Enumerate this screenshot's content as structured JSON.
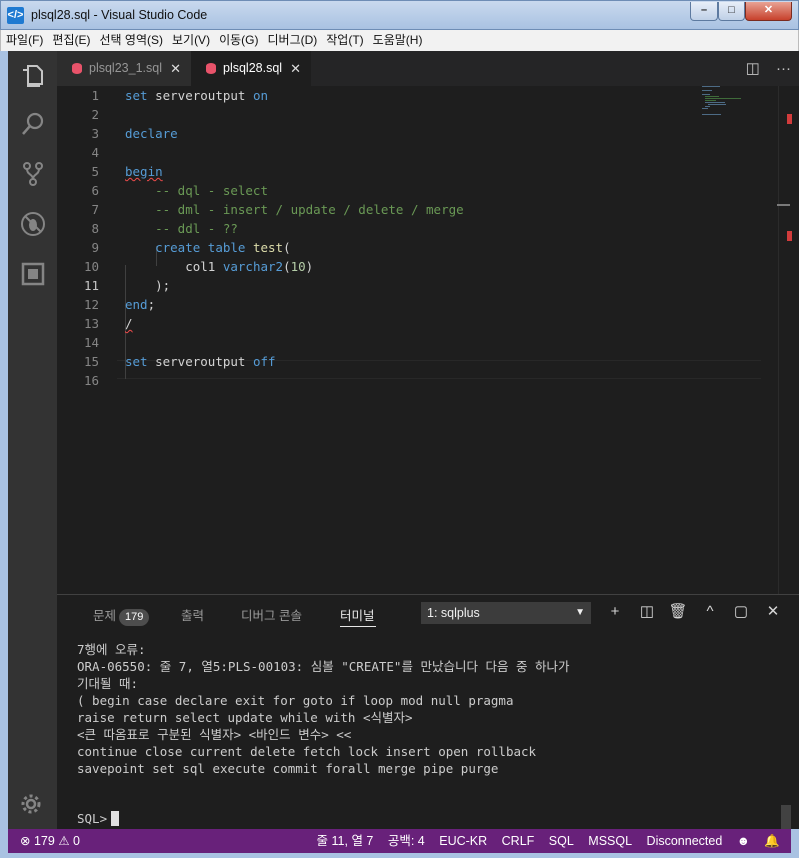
{
  "window": {
    "title": "plsql28.sql - Visual Studio Code",
    "min": "–",
    "max": "□",
    "close": "✕"
  },
  "menu": [
    "파일(F)",
    "편집(E)",
    "선택 영역(S)",
    "보기(V)",
    "이동(G)",
    "디버그(D)",
    "작업(T)",
    "도움말(H)"
  ],
  "tabs": [
    {
      "label": "plsql23_1.sql",
      "close": "✕"
    },
    {
      "label": "plsql28.sql",
      "close": "✕"
    }
  ],
  "tab_actions": {
    "split": "◫",
    "more": "···"
  },
  "editor": {
    "line_numbers": [
      "1",
      "2",
      "3",
      "4",
      "5",
      "6",
      "7",
      "8",
      "9",
      "10",
      "11",
      "12",
      "13",
      "14",
      "15",
      "16"
    ],
    "current_line": 11
  },
  "panel": {
    "tabs": {
      "problems": "문제",
      "problems_count": "179",
      "output": "출력",
      "debug_console": "디버그 콘솔",
      "terminal": "터미널"
    },
    "terminal_select": "1: sqlplus",
    "actions": {
      "new": "+",
      "split": "◫",
      "kill": "🗑",
      "maximize": "^",
      "toggle": "▢",
      "close": "✕"
    },
    "terminal_lines": [
      "7행에 오류:",
      "ORA-06550: 줄 7, 열5:PLS-00103: 심볼 \"CREATE\"를 만났습니다 다음 중 하나가",
      "기대될 때:",
      "( begin case declare exit for goto if loop mod null pragma",
      "raise return select update while with <식별자>",
      "<큰 따옴표로 구분된 식별자> <바인드 변수> <<",
      "continue close current delete fetch lock insert open rollback",
      "savepoint set sql execute commit forall merge pipe purge"
    ],
    "prompt": "SQL>"
  },
  "status": {
    "errors": "179",
    "warnings": "0",
    "position": "줄 11, 열 7",
    "spaces": "공백: 4",
    "encoding": "EUC-KR",
    "eol": "CRLF",
    "language": "SQL",
    "dialect": "MSSQL",
    "connection": "Disconnected"
  },
  "colors": {
    "statusbar": "#68217a",
    "keyword": "#569cd6",
    "comment": "#6a9955",
    "function": "#dcdcaa"
  }
}
